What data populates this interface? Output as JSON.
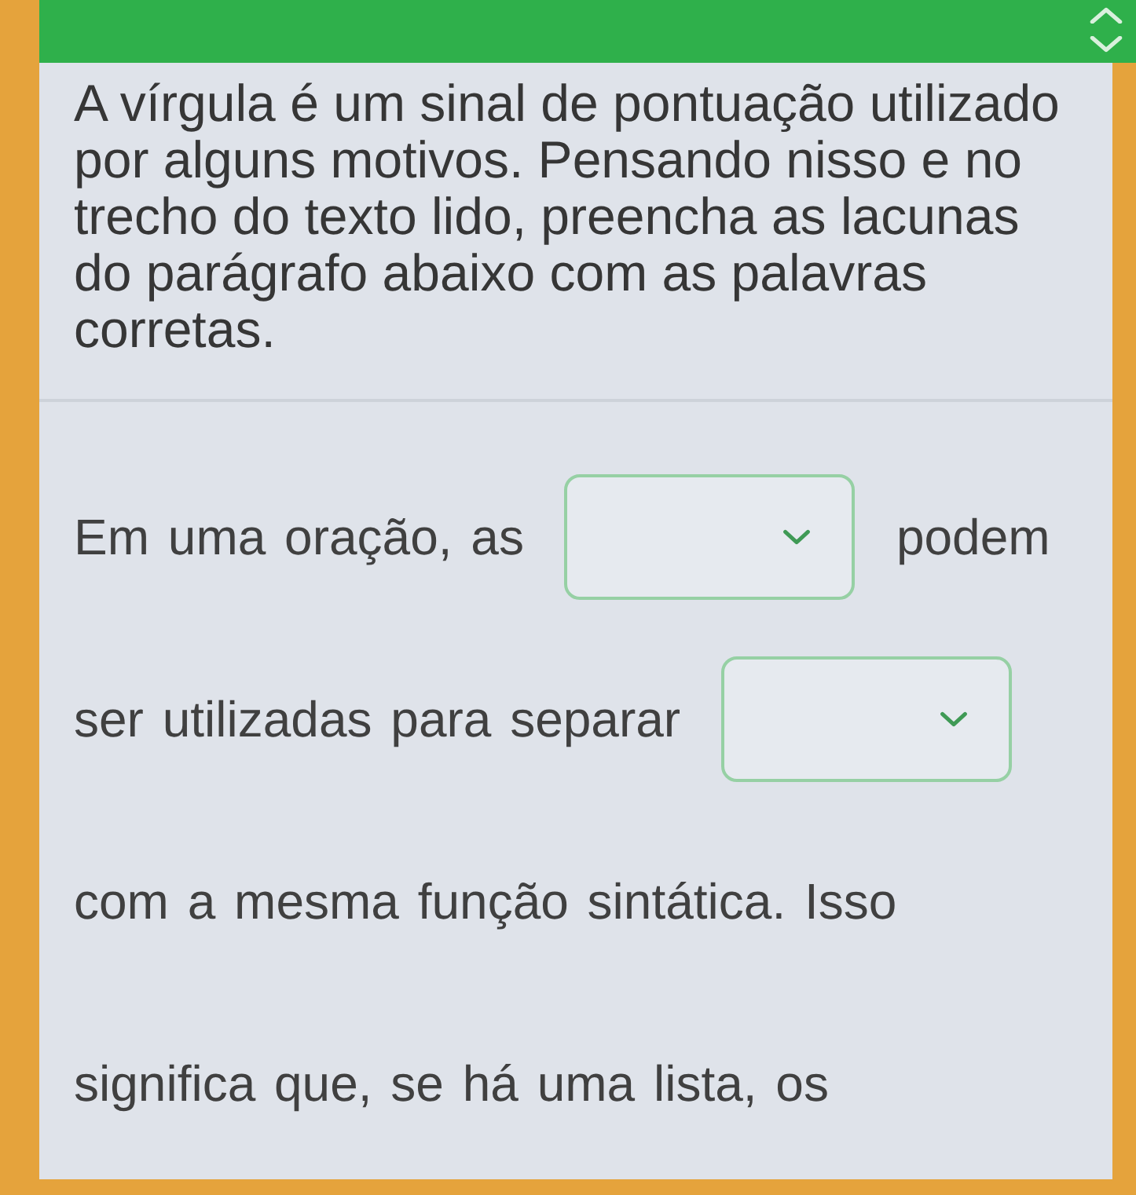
{
  "question": {
    "text": "A vírgula é um sinal de pontuação utilizado por alguns motivos. Pensando nisso e no trecho do texto lido, preencha as lacunas do parágrafo abaixo com as palavras corretas."
  },
  "exercise": {
    "lines": [
      {
        "segments": [
          {
            "kind": "text",
            "text": "Em uma oração, as"
          },
          {
            "kind": "dropdown"
          },
          {
            "kind": "text",
            "text": "podem"
          }
        ]
      },
      {
        "segments": [
          {
            "kind": "text",
            "text": "ser utilizadas para separar"
          },
          {
            "kind": "dropdown"
          }
        ]
      },
      {
        "segments": [
          {
            "kind": "text",
            "text": "com a mesma função sintática. Isso"
          }
        ]
      },
      {
        "segments": [
          {
            "kind": "text",
            "text": "significa que, se há uma lista, os"
          }
        ]
      }
    ]
  }
}
